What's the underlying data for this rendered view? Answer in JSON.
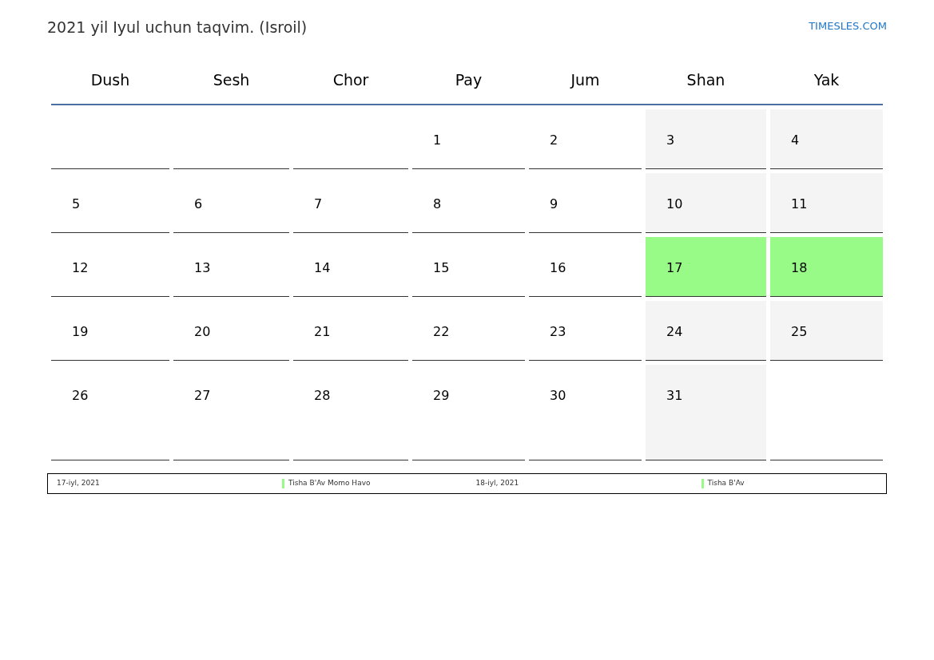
{
  "title": "2021 yil Iyul uchun taqvim. (Isroil)",
  "site_link": "TIMESLES.COM",
  "weekdays": [
    "Dush",
    "Sesh",
    "Chor",
    "Pay",
    "Jum",
    "Shan",
    "Yak"
  ],
  "weeks": [
    [
      {
        "kind": "plain"
      },
      {
        "kind": "plain"
      },
      {
        "kind": "plain"
      },
      {
        "day": "1",
        "kind": "plain"
      },
      {
        "day": "2",
        "kind": "plain"
      },
      {
        "day": "3",
        "kind": "weekend"
      },
      {
        "day": "4",
        "kind": "weekend"
      }
    ],
    [
      {
        "day": "5",
        "kind": "plain"
      },
      {
        "day": "6",
        "kind": "plain"
      },
      {
        "day": "7",
        "kind": "plain"
      },
      {
        "day": "8",
        "kind": "plain"
      },
      {
        "day": "9",
        "kind": "plain"
      },
      {
        "day": "10",
        "kind": "weekend"
      },
      {
        "day": "11",
        "kind": "weekend"
      }
    ],
    [
      {
        "day": "12",
        "kind": "plain"
      },
      {
        "day": "13",
        "kind": "plain"
      },
      {
        "day": "14",
        "kind": "plain"
      },
      {
        "day": "15",
        "kind": "plain"
      },
      {
        "day": "16",
        "kind": "plain"
      },
      {
        "day": "17",
        "kind": "holiday"
      },
      {
        "day": "18",
        "kind": "holiday"
      }
    ],
    [
      {
        "day": "19",
        "kind": "plain"
      },
      {
        "day": "20",
        "kind": "plain"
      },
      {
        "day": "21",
        "kind": "plain"
      },
      {
        "day": "22",
        "kind": "plain"
      },
      {
        "day": "23",
        "kind": "plain"
      },
      {
        "day": "24",
        "kind": "weekend"
      },
      {
        "day": "25",
        "kind": "weekend"
      }
    ],
    [
      {
        "day": "26",
        "kind": "plain"
      },
      {
        "day": "27",
        "kind": "plain"
      },
      {
        "day": "28",
        "kind": "plain"
      },
      {
        "day": "29",
        "kind": "plain"
      },
      {
        "day": "30",
        "kind": "plain"
      },
      {
        "day": "31",
        "kind": "weekend"
      },
      {
        "kind": "plain"
      }
    ]
  ],
  "holidays": [
    {
      "date": "17-iyl, 2021",
      "name": "Tisha B'Av Momo Havo",
      "color": "#98fb88"
    },
    {
      "date": "18-iyl, 2021",
      "name": "Tisha B'Av",
      "color": "#98fb88"
    }
  ]
}
